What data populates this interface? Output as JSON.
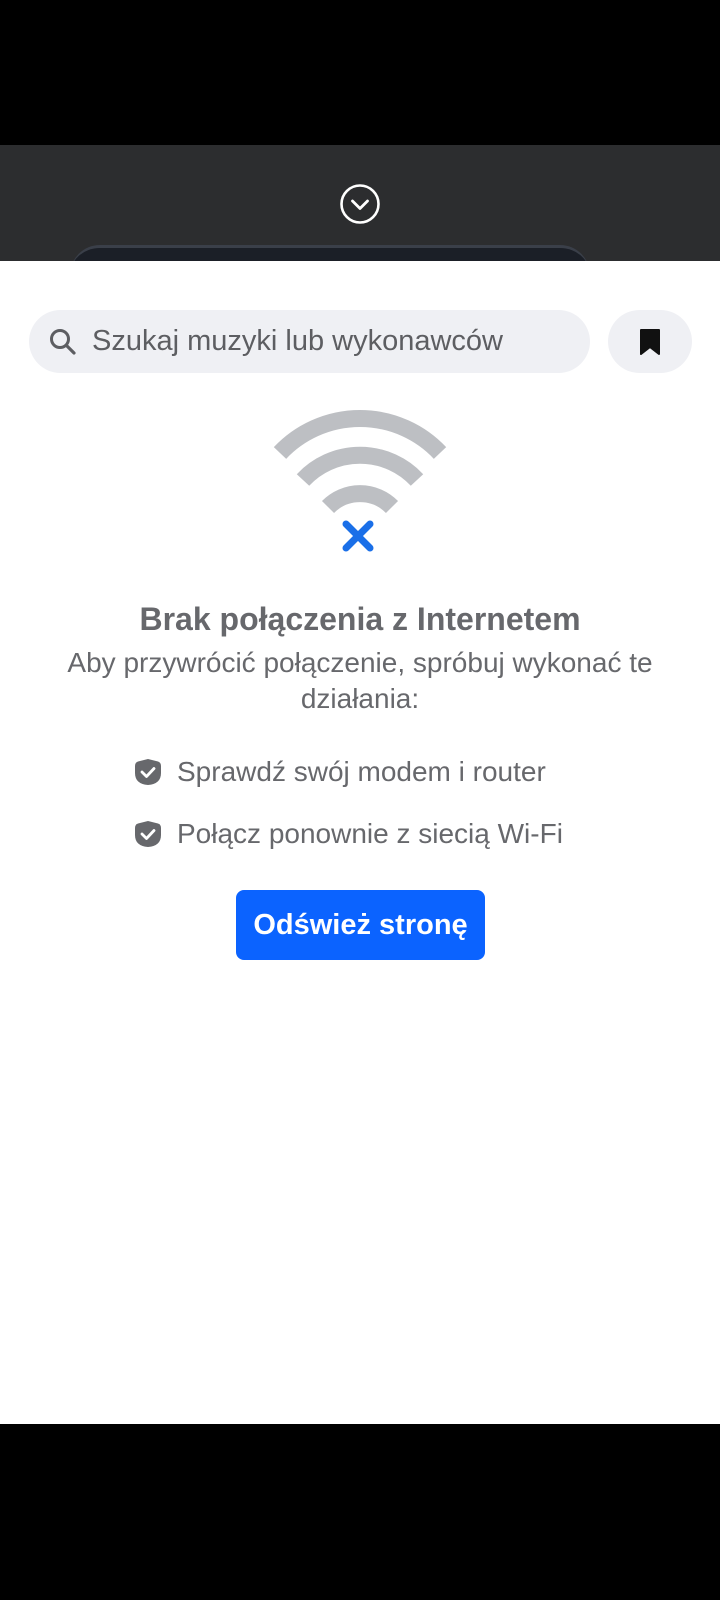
{
  "search": {
    "placeholder": "Szukaj muzyki lub wykonawców"
  },
  "error": {
    "title": "Brak połączenia z Internetem",
    "subtitle": "Aby przywrócić połączenie, spróbuj wykonać te działania:",
    "tips": [
      "Sprawdź swój modem i router",
      "Połącz ponownie z siecią Wi-Fi"
    ],
    "refresh_label": "Odśwież stronę"
  },
  "colors": {
    "accent": "#0b63ff",
    "text": "#67686c",
    "search_bg": "#eff0f4",
    "wifi_gray": "#bdbfc3"
  },
  "icons": {
    "collapse": "chevron-down-circle-icon",
    "search": "search-icon",
    "bookmark": "bookmark-icon",
    "wifi_off": "wifi-off-icon",
    "check": "check-badge-icon"
  }
}
